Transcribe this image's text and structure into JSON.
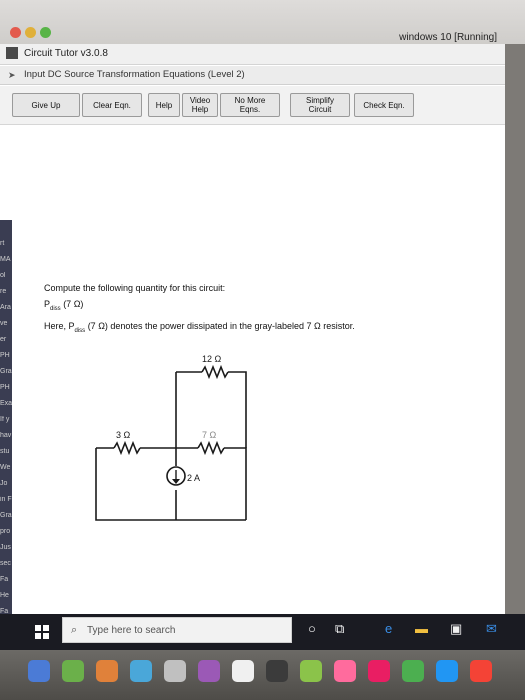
{
  "vm": {
    "title": "windows 10 [Running]"
  },
  "app": {
    "title": "Circuit Tutor v3.0.8",
    "subtitle": "Input DC Source Transformation Equations (Level 2)"
  },
  "toolbar": {
    "buttons": [
      {
        "id": "give-up",
        "label": "Give Up"
      },
      {
        "id": "clear-eqn",
        "label": "Clear Eqn."
      },
      {
        "id": "help",
        "label": "Help"
      },
      {
        "id": "video-help",
        "label": "Video\nHelp"
      },
      {
        "id": "no-more-eqns",
        "label": "No More\nEqns."
      },
      {
        "id": "simplify-circuit",
        "label": "Simplify\nCircuit"
      },
      {
        "id": "check-eqn",
        "label": "Check Eqn."
      }
    ]
  },
  "problem": {
    "prompt": "Compute the following quantity for this circuit:",
    "quantity_p": "P",
    "quantity_sub": "diss",
    "quantity_arg": " (7 Ω)",
    "here_prefix": "Here, P",
    "here_sub": "diss",
    "here_rest": " (7 Ω) denotes the power dissipated in the gray-labeled 7 Ω resistor."
  },
  "circuit": {
    "r_top": "12 Ω",
    "r_left": "3 Ω",
    "r_right": "7 Ω",
    "source": "2 A",
    "colors": {
      "wire": "#1a1a1a",
      "gray_label": "#888888"
    }
  },
  "left_strip": [
    "rt",
    "MA",
    "ol",
    "re",
    "Ara",
    "ve",
    "er",
    "PH",
    "Gra",
    "PH",
    "Exa",
    "If y",
    "hav",
    "stu",
    "We",
    "Jo",
    "in F",
    "Gra",
    "pro",
    "Jus",
    "sec",
    "Fa",
    "He",
    "Fa"
  ],
  "taskbar": {
    "search_placeholder": "Type here to search"
  }
}
